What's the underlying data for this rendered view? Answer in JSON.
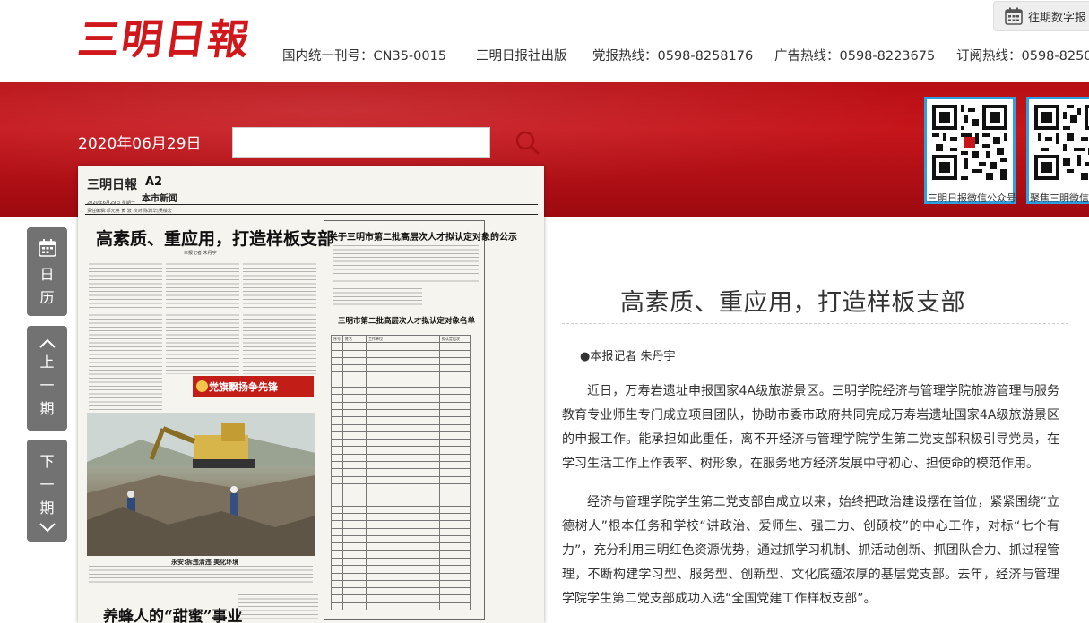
{
  "header": {
    "logo_text": "三明日報",
    "issn": "国内统一刊号：CN35-0015",
    "publisher": "三明日报社出版",
    "party_hotline": "党报热线：0598-8258176",
    "ad_hotline": "广告热线：0598-8223675",
    "subscribe_hotline": "订阅热线：0598-8250",
    "archive_button": "往期数字报"
  },
  "toolbar": {
    "date": "2020年06月29日",
    "date_value": ""
  },
  "qr_codes": [
    {
      "caption": "三明日报微信公众号"
    },
    {
      "caption": "聚焦三明微信公"
    }
  ],
  "side_nav": {
    "calendar": [
      "日",
      "历"
    ],
    "prev": [
      "上",
      "一",
      "期"
    ],
    "next": [
      "下",
      "一",
      "期"
    ]
  },
  "newspaper": {
    "logo": "三明日報",
    "page_no": "A2",
    "section": "本市新闻",
    "header_line": "2020年6月29日 星期一",
    "editor_line": "责任编辑:邓元英 黄 波 校对:陈渊华|吴葆宏",
    "headline": "高素质、重应用，打造样板支部",
    "byline": "本报记者 朱丹宇",
    "banner": "党旗飘扬争先锋",
    "photo_caption": "永安:拆违清违 美化环境",
    "headline2": "养蜂人的“甜蜜”事业",
    "notice_title": "关于三明市第二批高层次人才拟认定对象的公示",
    "table_title": "三明市第二批高层次人才拟认定对象名单",
    "table_header": [
      "序号",
      "姓名",
      "工作单位",
      "拟认定层次"
    ]
  },
  "article": {
    "title": "高素质、重应用，打造样板支部",
    "byline": "●本报记者 朱丹宇",
    "paragraphs": [
      "近日，万寿岩遗址申报国家4A级旅游景区。三明学院经济与管理学院旅游管理与服务教育专业师生专门成立项目团队，协助市委市政府共同完成万寿岩遗址国家4A级旅游景区的申报工作。能承担如此重任，离不开经济与管理学院学生第二党支部积极引导党员，在学习生活工作上作表率、树形象，在服务地方经济发展中守初心、担使命的模范作用。",
      "经济与管理学院学生第二党支部自成立以来，始终把政治建设摆在首位，紧紧围绕“立德树人”根本任务和学校“讲政治、爱师生、强三力、创硕校”的中心工作，对标“七个有力”，充分利用三明红色资源优势，通过抓学习机制、抓活动创新、抓团队合力、抓过程管理，不断构建学习型、服务型、创新型、文化底蕴浓厚的基层党支部。去年，经济与管理学院学生第二党支部成功入选“全国党建工作样板支部”。"
    ]
  }
}
